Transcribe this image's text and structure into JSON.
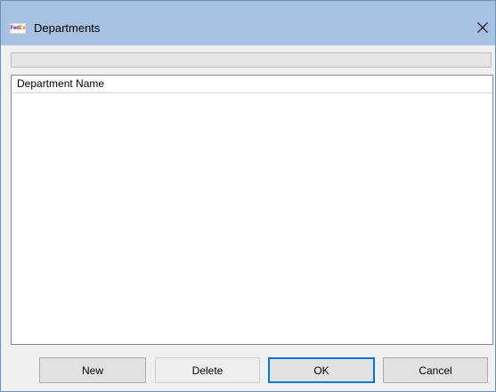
{
  "window": {
    "title": "Departments",
    "icon": "fedex-app-icon",
    "icon_text_purple": "Fed",
    "icon_text_orange": "Ex"
  },
  "progress": {
    "value": 0
  },
  "list": {
    "columns": [
      "Department Name"
    ],
    "rows": []
  },
  "buttons": {
    "new_label": "New",
    "delete_label": "Delete",
    "ok_label": "OK",
    "cancel_label": "Cancel"
  },
  "colors": {
    "titlebar": "#a7c1e2",
    "dialog_bg": "#f0f0f0",
    "default_button_border": "#0078d7"
  }
}
